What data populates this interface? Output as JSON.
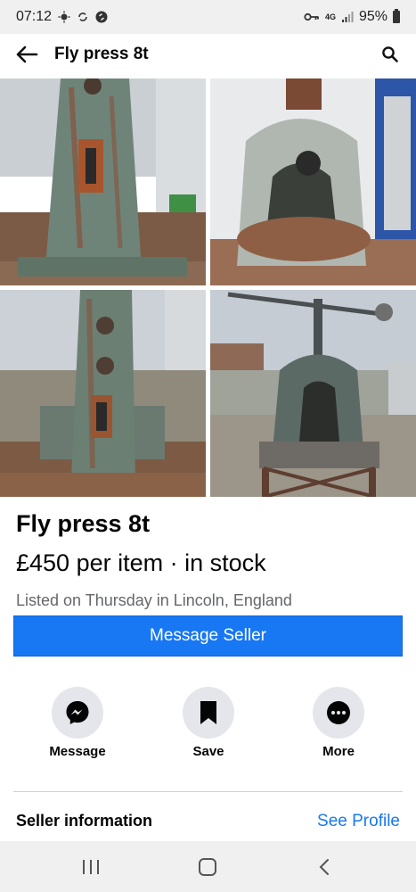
{
  "status_bar": {
    "time": "07:12",
    "network": "4G",
    "battery": "95%",
    "icons": [
      "weather-icon",
      "sync-icon",
      "shazam-icon",
      "key-icon",
      "signal-icon",
      "battery-icon"
    ]
  },
  "header": {
    "title": "Fly press 8t",
    "back_icon": "arrow-left-icon",
    "search_icon": "search-icon"
  },
  "photos": [
    {
      "name": "photo-1"
    },
    {
      "name": "photo-2"
    },
    {
      "name": "photo-3"
    },
    {
      "name": "photo-4"
    }
  ],
  "listing": {
    "title": "Fly press 8t",
    "price_line": "£450 per item · in stock",
    "listed": "Listed on Thursday in Lincoln, England",
    "message_seller": "Message Seller"
  },
  "actions": [
    {
      "label": "Message",
      "icon": "messenger-icon"
    },
    {
      "label": "Save",
      "icon": "bookmark-icon"
    },
    {
      "label": "More",
      "icon": "more-icon"
    }
  ],
  "seller": {
    "heading": "Seller information",
    "see_profile": "See Profile"
  },
  "nav": {
    "recent_icon": "recent-apps-icon",
    "home_icon": "home-icon",
    "back_icon": "back-icon"
  },
  "colors": {
    "accent": "#1877f2",
    "icon_bg": "#e4e6eb",
    "muted_text": "#65676b"
  }
}
